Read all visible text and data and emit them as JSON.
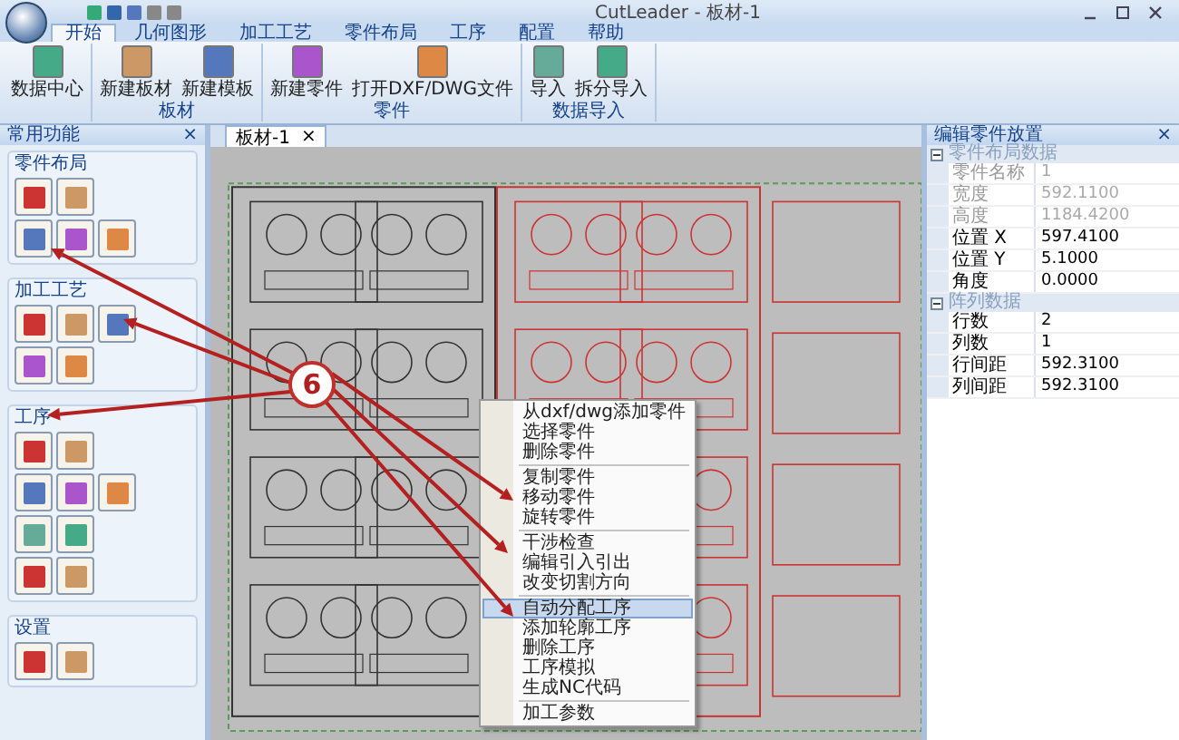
{
  "window": {
    "title": "CutLeader - 板材-1"
  },
  "ribbon": {
    "tabs": [
      {
        "label": "开始",
        "selected": true
      },
      {
        "label": "几何图形",
        "selected": false
      },
      {
        "label": "加工工艺",
        "selected": false
      },
      {
        "label": "零件布局",
        "selected": false
      },
      {
        "label": "工序",
        "selected": false
      },
      {
        "label": "配置",
        "selected": false
      },
      {
        "label": "帮助",
        "selected": false
      }
    ],
    "groups": [
      {
        "buttons": [
          {
            "label": "数据中心"
          }
        ]
      },
      {
        "label": "板材",
        "buttons": [
          {
            "label": "新建板材"
          },
          {
            "label": "新建模板"
          }
        ]
      },
      {
        "label": "零件",
        "buttons": [
          {
            "label": "新建零件"
          },
          {
            "label": "打开DXF/DWG文件"
          }
        ]
      },
      {
        "label": "数据导入",
        "buttons": [
          {
            "label": "导入"
          },
          {
            "label": "拆分导入"
          }
        ]
      }
    ]
  },
  "left_panel": {
    "title": "常用功能",
    "close": "×",
    "groups": [
      {
        "label": "零件布局",
        "rows": [
          [
            {
              "kind": "tool"
            },
            {
              "kind": "tool"
            }
          ],
          [
            {
              "kind": "tool"
            },
            {
              "kind": "tool"
            },
            {
              "kind": "tool"
            }
          ]
        ]
      },
      {
        "label": "加工工艺",
        "rows": [
          [
            {
              "kind": "tool"
            },
            {
              "kind": "tool"
            },
            {
              "kind": "tool"
            }
          ],
          [
            {
              "kind": "tool"
            },
            {
              "kind": "tool"
            }
          ]
        ]
      },
      {
        "label": "工序",
        "rows": [
          [
            {
              "kind": "tool"
            },
            {
              "kind": "tool"
            }
          ],
          [
            {
              "kind": "tool"
            },
            {
              "kind": "tool"
            },
            {
              "kind": "tool"
            }
          ],
          [
            {
              "kind": "tool"
            },
            {
              "kind": "tool"
            }
          ],
          [
            {
              "kind": "tool"
            },
            {
              "kind": "tool"
            }
          ]
        ]
      },
      {
        "label": "设置",
        "rows": [
          [
            {
              "kind": "tool"
            },
            {
              "kind": "tool"
            }
          ]
        ]
      }
    ]
  },
  "document_tab": {
    "label": "板材-1",
    "close": "×",
    "selected": true
  },
  "context_menu": {
    "items": [
      {
        "kind": "item",
        "label": "从dxf/dwg添加零件",
        "selected": false
      },
      {
        "kind": "item",
        "label": "选择零件",
        "selected": false
      },
      {
        "kind": "item",
        "label": "删除零件",
        "selected": false
      },
      {
        "kind": "separator"
      },
      {
        "kind": "item",
        "label": "复制零件",
        "selected": false
      },
      {
        "kind": "item",
        "label": "移动零件",
        "selected": false
      },
      {
        "kind": "item",
        "label": "旋转零件",
        "selected": false
      },
      {
        "kind": "separator"
      },
      {
        "kind": "item",
        "label": "干涉检查",
        "selected": false
      },
      {
        "kind": "item",
        "label": "编辑引入引出",
        "selected": false
      },
      {
        "kind": "item",
        "label": "改变切割方向",
        "selected": false
      },
      {
        "kind": "separator"
      },
      {
        "kind": "item",
        "label": "自动分配工序",
        "selected": true
      },
      {
        "kind": "item",
        "label": "添加轮廓工序",
        "selected": false
      },
      {
        "kind": "item",
        "label": "删除工序",
        "selected": false
      },
      {
        "kind": "item",
        "label": "工序模拟",
        "selected": false
      },
      {
        "kind": "item",
        "label": "生成NC代码",
        "selected": false
      },
      {
        "kind": "separator"
      },
      {
        "kind": "item",
        "label": "加工参数",
        "selected": false
      }
    ]
  },
  "right_panel": {
    "title": "编辑零件放置",
    "close": "×",
    "sections": [
      {
        "title": "零件布局数据",
        "expanded": true,
        "rows": [
          {
            "name": "零件名称",
            "value": "1",
            "disabled": true
          },
          {
            "name": "宽度",
            "value": "592.1100",
            "disabled": true
          },
          {
            "name": "高度",
            "value": "1184.4200",
            "disabled": true
          },
          {
            "name": "位置 X",
            "value": "597.4100",
            "disabled": false
          },
          {
            "name": "位置 Y",
            "value": "5.1000",
            "disabled": false
          },
          {
            "name": "角度",
            "value": "0.0000",
            "disabled": false
          }
        ]
      },
      {
        "title": "阵列数据",
        "expanded": true,
        "rows": [
          {
            "name": "行数",
            "value": "2",
            "disabled": false
          },
          {
            "name": "列数",
            "value": "1",
            "disabled": false
          },
          {
            "name": "行间距",
            "value": "592.3100",
            "disabled": false
          },
          {
            "name": "列间距",
            "value": "592.3100",
            "disabled": false
          }
        ]
      }
    ]
  },
  "annotation": {
    "label": "6"
  }
}
